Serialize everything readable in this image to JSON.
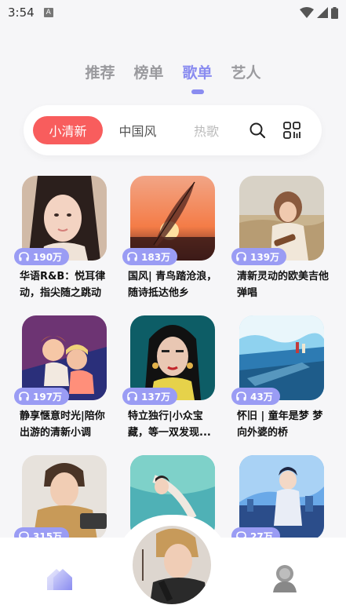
{
  "status": {
    "time": "3:54",
    "app_badge": "A"
  },
  "top_tabs": [
    "推荐",
    "榜单",
    "歌单",
    "艺人"
  ],
  "active_tab_index": 2,
  "categories": {
    "items": [
      "小清新",
      "中国风",
      "热歌"
    ],
    "active_index": 0
  },
  "playlists": [
    {
      "count": "190万",
      "title": "华语R&B：悦耳律动，指尖随之跳动"
    },
    {
      "count": "183万",
      "title": "国风| 青鸟踏沧浪，随诗抵达他乡"
    },
    {
      "count": "139万",
      "title": "清新灵动的欧美吉他弹唱"
    },
    {
      "count": "197万",
      "title": "静享惬意时光|陪你出游的清新小调"
    },
    {
      "count": "137万",
      "title": "特立独行|小众宝藏，等一双发现..."
    },
    {
      "count": "43万",
      "title": "怀旧 | 童年是梦 梦向外婆的桥"
    },
    {
      "count": "315万",
      "title": ""
    },
    {
      "count": "",
      "title": ""
    },
    {
      "count": "27万",
      "title": ""
    }
  ],
  "colors": {
    "accent": "#8a8cf0",
    "category_active": "#f85d5d",
    "badge": "#9a9cf4"
  }
}
